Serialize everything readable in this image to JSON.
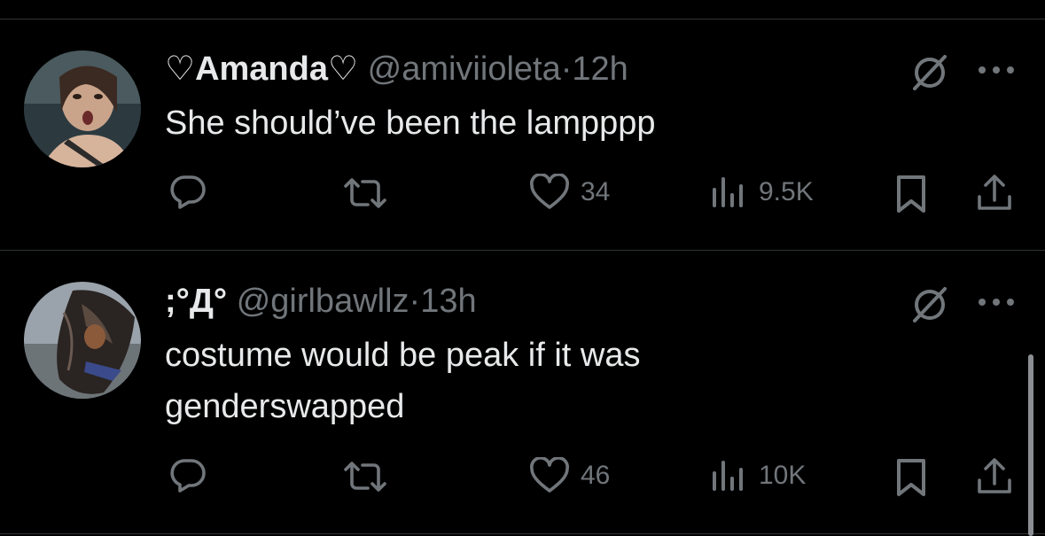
{
  "tweets": [
    {
      "display_name": "♡Amanda♡",
      "handle": "@amiviioleta",
      "separator": "·",
      "time": "12h",
      "text_lines": [
        "She should’ve been the lampppp"
      ],
      "likes": "34",
      "views": "9.5K",
      "avatar_colors": [
        "#c9a48a",
        "#6b4a3a",
        "#2c3a40"
      ]
    },
    {
      "display_name": ";°Д°",
      "handle": "@girlbawllz",
      "separator": "·",
      "time": "13h",
      "text_lines": [
        "costume would be peak if it was",
        "genderswapped"
      ],
      "likes": "46",
      "views": "10K",
      "avatar_colors": [
        "#9aa3ab",
        "#3a3230",
        "#1e1c1c"
      ]
    }
  ],
  "icons": {
    "reply": "reply-icon",
    "repost": "repost-icon",
    "like": "heart-icon",
    "views": "views-icon",
    "bookmark": "bookmark-icon",
    "share": "share-icon",
    "grok": "grok-icon",
    "more": "more-icon"
  },
  "colors": {
    "background": "#000000",
    "text": "#e7e9ea",
    "muted": "#71767b",
    "divider": "#2f3336"
  }
}
